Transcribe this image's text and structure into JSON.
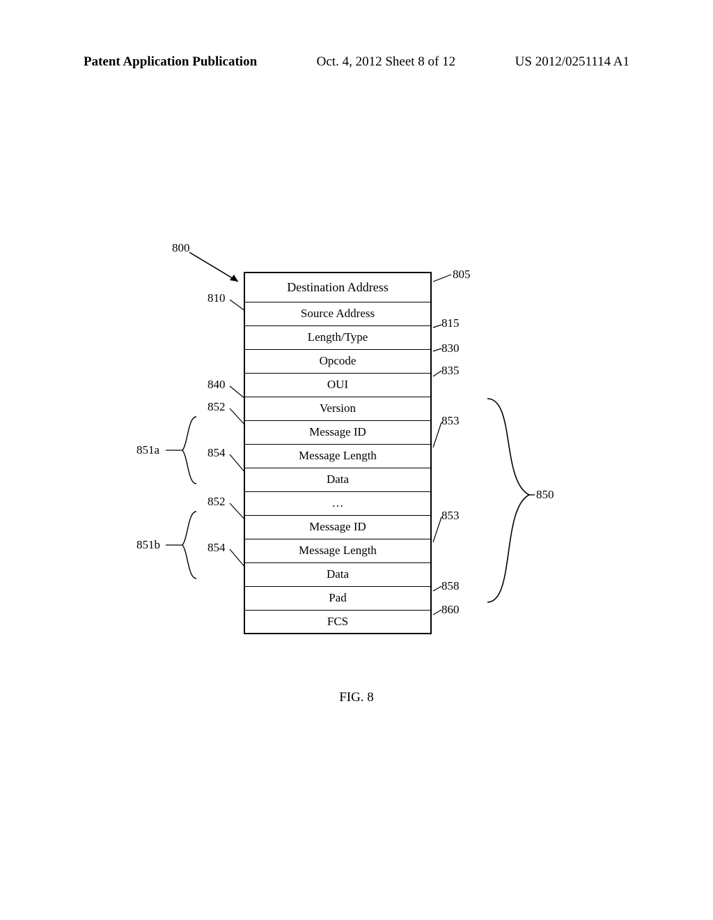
{
  "header": {
    "left": "Patent Application Publication",
    "center": "Oct. 4, 2012   Sheet 8 of 12",
    "right": "US 2012/0251114 A1"
  },
  "diagram": {
    "main_ref": "800",
    "rows": [
      "Destination Address",
      "Source Address",
      "Length/Type",
      "Opcode",
      "OUI",
      "Version",
      "Message ID",
      "Message Length",
      "Data",
      "…",
      "Message ID",
      "Message Length",
      "Data",
      "Pad",
      "FCS"
    ],
    "labels": {
      "r805": "805",
      "r810": "810",
      "r815": "815",
      "r830": "830",
      "r835": "835",
      "r840": "840",
      "r852a": "852",
      "r851a": "851a",
      "r854a": "854",
      "r853a": "853",
      "r852b": "852",
      "r851b": "851b",
      "r854b": "854",
      "r853b": "853",
      "r858": "858",
      "r860": "860",
      "r850": "850"
    },
    "caption": "FIG. 8"
  }
}
